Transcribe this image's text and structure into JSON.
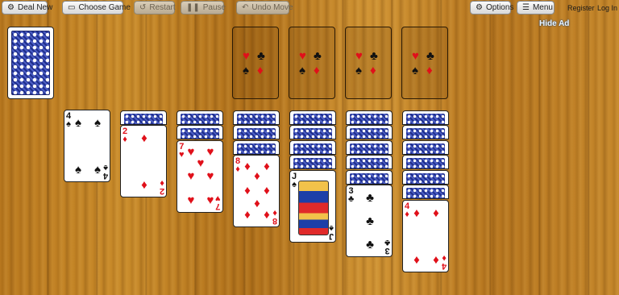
{
  "toolbar": {
    "deal_new": "Deal New",
    "choose_game": "Choose Game",
    "restart": "Restart",
    "pause": "Pause",
    "undo_move": "Undo Move",
    "options": "Options",
    "menu": "Menu",
    "register": "Register",
    "log_in": "Log In"
  },
  "ad": {
    "hide_ad": "Hide Ad"
  },
  "suits": {
    "heart": "♥",
    "club": "♣",
    "spade": "♠",
    "diamond": "♦"
  },
  "tableau": {
    "col1": {
      "rank": "4",
      "suit": "♠"
    },
    "col2": {
      "rank": "2",
      "suit": "♦"
    },
    "col3": {
      "rank": "7",
      "suit": "♥"
    },
    "col4": {
      "rank": "8",
      "suit": "♦"
    },
    "col5": {
      "rank": "J",
      "suit": "♠"
    },
    "col6": {
      "rank": "3",
      "suit": "♣"
    },
    "col7": {
      "rank": "4",
      "suit": "♦"
    }
  },
  "colors": {
    "red_suit": "#e0101a",
    "black_suit": "#111111",
    "card_back": "#2b3a9e"
  }
}
